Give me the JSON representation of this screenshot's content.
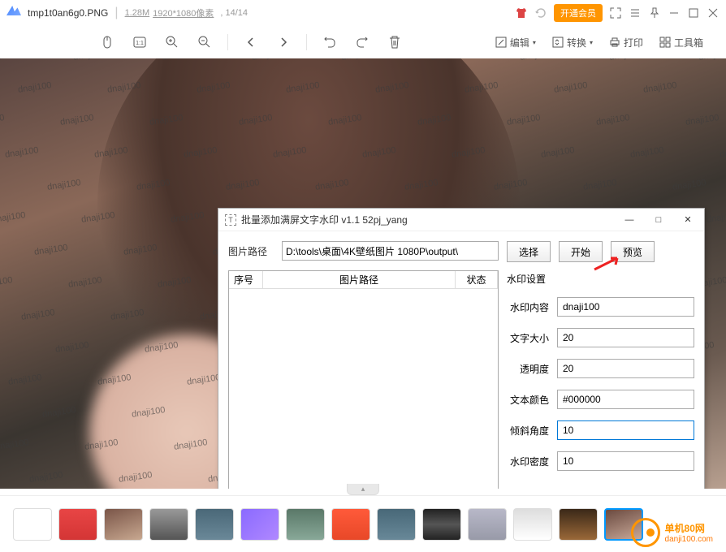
{
  "titlebar": {
    "filename": "tmp1t0an6g0.PNG",
    "filesize": "1.28M",
    "dimensions": "1920*1080像素",
    "position": "14/14",
    "vip_label": "开通会员"
  },
  "toolbar": {
    "edit": "编辑",
    "convert": "转换",
    "print": "打印",
    "toolbox": "工具箱"
  },
  "watermark_text": "dnaji100",
  "dialog": {
    "title": "批量添加满屏文字水印 v1.1    52pj_yang",
    "path_label": "图片路径",
    "path_value": "D:\\tools\\桌面\\4K壁纸图片 1080P\\output\\",
    "select_btn": "选择",
    "start_btn": "开始",
    "preview_btn": "预览",
    "col_index": "序号",
    "col_path": "图片路径",
    "col_status": "状态",
    "settings_title": "水印设置",
    "fields": {
      "content_label": "水印内容",
      "content_value": "dnaji100",
      "size_label": "文字大小",
      "size_value": "20",
      "opacity_label": "透明度",
      "opacity_value": "20",
      "color_label": "文本颜色",
      "color_value": "#000000",
      "angle_label": "倾斜角度",
      "angle_value": "10",
      "density_label": "水印密度",
      "density_value": "10"
    }
  },
  "site": {
    "name": "单机80网",
    "url": "danji100.com"
  },
  "thumbs": [
    {
      "bg": "#fff"
    },
    {
      "bg": "linear-gradient(#e84545,#d43535)"
    },
    {
      "bg": "linear-gradient(160deg,#7a5548,#c8a890)"
    },
    {
      "bg": "linear-gradient(#999,#555)"
    },
    {
      "bg": "linear-gradient(#4a6878,#6a8898)"
    },
    {
      "bg": "linear-gradient(135deg,#8a6aff,#b088ff)"
    },
    {
      "bg": "linear-gradient(#5a7868,#88a898)"
    },
    {
      "bg": "linear-gradient(#ff5a3a,#e84828)"
    },
    {
      "bg": "linear-gradient(#486878,#688898)"
    },
    {
      "bg": "linear-gradient(#222,#555,#222)"
    },
    {
      "bg": "linear-gradient(#b8b8c8,#989aa8)"
    },
    {
      "bg": "linear-gradient(#ddd,#fff)"
    },
    {
      "bg": "linear-gradient(#3a2818,#6a4828,#9a6838)"
    },
    {
      "bg": "linear-gradient(160deg,#6a4a40,#c8a898)",
      "sel": true
    }
  ]
}
